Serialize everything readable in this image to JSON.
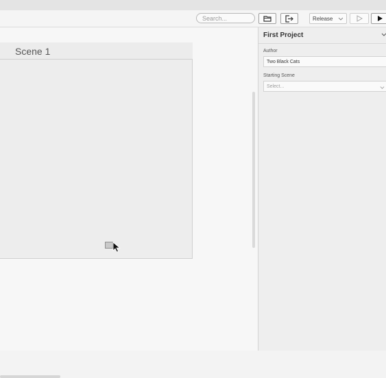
{
  "toolbar": {
    "search_placeholder": "Search...",
    "open_project_icon": "folder-icon",
    "export_icon": "export-icon",
    "build_mode": "Release",
    "run_icon": "play-outline-icon",
    "play_icon": "play-icon"
  },
  "canvas": {
    "scene": {
      "title": "Scene 1",
      "actor_icon": "actor-square-icon"
    }
  },
  "sidebar": {
    "project_title": "First Project",
    "fields": {
      "author_label": "Author",
      "author_value": "Two Black Cats",
      "starting_scene_label": "Starting Scene",
      "starting_scene_placeholder": "Select..."
    }
  },
  "colors": {
    "background": "#f3f3f3",
    "scene_bg": "#ededed",
    "sidebar_bg": "#eeeeee"
  }
}
